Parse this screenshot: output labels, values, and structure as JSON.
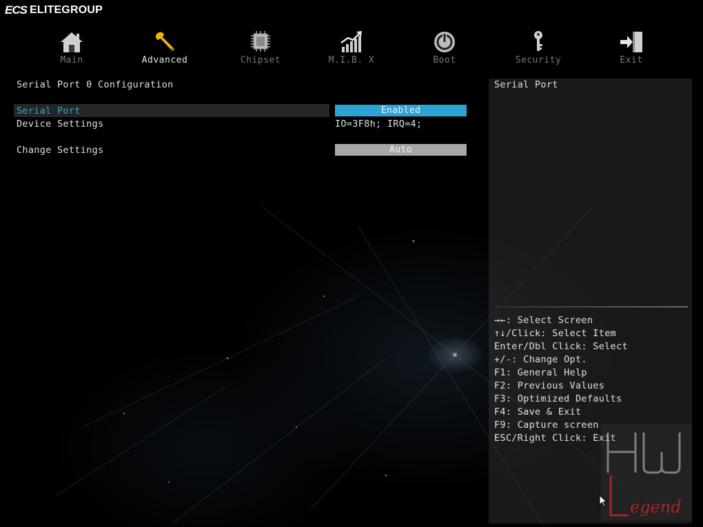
{
  "brand": {
    "mark": "ECS",
    "name": "ELITEGROUP"
  },
  "tabs": [
    {
      "label": "Main",
      "icon": "home-icon",
      "active": false
    },
    {
      "label": "Advanced",
      "icon": "wrench-icon",
      "active": true
    },
    {
      "label": "Chipset",
      "icon": "chip-icon",
      "active": false
    },
    {
      "label": "M.I.B. X",
      "icon": "chart-icon",
      "active": false
    },
    {
      "label": "Boot",
      "icon": "power-icon",
      "active": false
    },
    {
      "label": "Security",
      "icon": "key-icon",
      "active": false
    },
    {
      "label": "Exit",
      "icon": "exit-icon",
      "active": false
    }
  ],
  "page": {
    "title": "Serial Port 0 Configuration",
    "items": [
      {
        "label": "Serial Port",
        "value": "Enabled",
        "selected": true
      },
      {
        "label": "Device Settings",
        "value": "IO=3F8h; IRQ=4;"
      },
      {
        "label": "Change Settings",
        "value": "Auto"
      }
    ]
  },
  "help": {
    "title": "Serial Port",
    "keys": [
      "→←: Select Screen",
      "↑↓/Click: Select Item",
      "Enter/Dbl Click: Select",
      "+/-: Change Opt.",
      "F1: General Help",
      "F2: Previous Values",
      "F3: Optimized Defaults",
      "F4: Save & Exit",
      "F9: Capture screen",
      "ESC/Right Click: Exit"
    ]
  },
  "watermark": {
    "top": "HW",
    "bottom": "Legend"
  },
  "colors": {
    "accent": "#2ea3d6",
    "active_tab": "#f2b311",
    "inactive_value": "#a8a8a8"
  }
}
